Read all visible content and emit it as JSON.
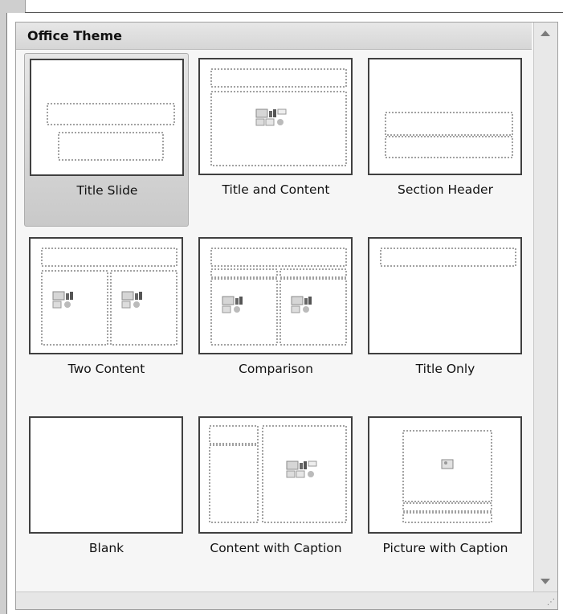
{
  "gallery": {
    "header_title": "Office Theme",
    "layouts": [
      {
        "name": "Title Slide",
        "selected": true
      },
      {
        "name": "Title and Content",
        "selected": false
      },
      {
        "name": "Section Header",
        "selected": false
      },
      {
        "name": "Two Content",
        "selected": false
      },
      {
        "name": "Comparison",
        "selected": false
      },
      {
        "name": "Title Only",
        "selected": false
      },
      {
        "name": "Blank",
        "selected": false
      },
      {
        "name": "Content with Caption",
        "selected": false
      },
      {
        "name": "Picture with Caption",
        "selected": false
      }
    ]
  },
  "icons": {
    "scroll_up": "chevron-up-icon",
    "scroll_down": "chevron-down-icon",
    "resize": "resize-grip-icon",
    "content_placeholder": "content-placeholder-icon",
    "picture_placeholder": "picture-placeholder-icon"
  },
  "colors": {
    "border": "#404040",
    "selected": "#c9c9c9",
    "header": "#dcdcdc"
  }
}
